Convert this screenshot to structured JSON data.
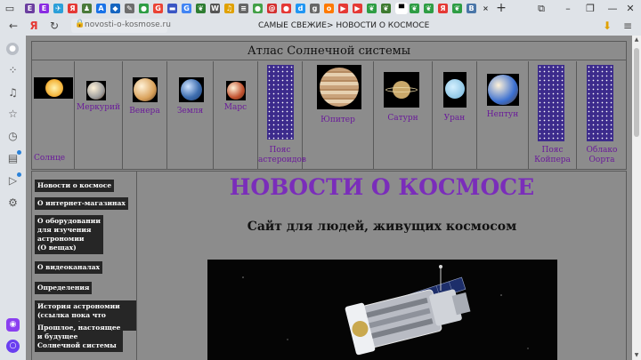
{
  "browser": {
    "tabs": [
      {
        "icon": "dzen-icon",
        "color": "#6b3fa0",
        "glyph": "Е"
      },
      {
        "icon": "dzen-icon",
        "color": "#8a2be2",
        "glyph": "Е"
      },
      {
        "icon": "telegram-icon",
        "color": "#2b9fd9",
        "glyph": "✈"
      },
      {
        "icon": "yandex-icon",
        "color": "#e53935",
        "glyph": "Я"
      },
      {
        "icon": "game-icon",
        "color": "#4a7a3a",
        "glyph": "♟"
      },
      {
        "icon": "translate-icon",
        "color": "#1a73e8",
        "glyph": "A"
      },
      {
        "icon": "bookmark-icon",
        "color": "#1565c0",
        "glyph": "◆"
      },
      {
        "icon": "feather-icon",
        "color": "#6d6d6d",
        "glyph": "✎"
      },
      {
        "icon": "green-circle-icon",
        "color": "#2e9d44",
        "glyph": "●"
      },
      {
        "icon": "google-icon",
        "color": "#ea4335",
        "glyph": "G"
      },
      {
        "icon": "flag-icon",
        "color": "#3a56c4",
        "glyph": "▬"
      },
      {
        "icon": "g-icon",
        "color": "#4285f4",
        "glyph": "G"
      },
      {
        "icon": "leaf-icon",
        "color": "#2e7d32",
        "glyph": "❦"
      },
      {
        "icon": "w-icon",
        "color": "#555555",
        "glyph": "W"
      },
      {
        "icon": "bird-icon",
        "color": "#e0a100",
        "glyph": "♫"
      },
      {
        "icon": "fan-icon",
        "color": "#666666",
        "glyph": "≡"
      },
      {
        "icon": "green-dot-icon",
        "color": "#43a047",
        "glyph": "●"
      },
      {
        "icon": "mail-icon",
        "color": "#d32f2f",
        "glyph": "@"
      },
      {
        "icon": "pin-icon",
        "color": "#e53935",
        "glyph": "●"
      },
      {
        "icon": "d-icon",
        "color": "#2196f3",
        "glyph": "d"
      },
      {
        "icon": "g-icon",
        "color": "#666666",
        "glyph": "g"
      },
      {
        "icon": "ok-icon",
        "color": "#ff7a00",
        "glyph": "o"
      },
      {
        "icon": "youtube-icon",
        "color": "#e53935",
        "glyph": "▶"
      },
      {
        "icon": "youtube-icon",
        "color": "#e53935",
        "glyph": "▶"
      },
      {
        "icon": "leaf-icon",
        "color": "#2e9d44",
        "glyph": "❦"
      },
      {
        "icon": "leaf-icon",
        "color": "#3d7a30",
        "glyph": "❦"
      },
      {
        "icon": "current-tab-icon",
        "color": "#ffffff",
        "glyph": "▀"
      },
      {
        "icon": "leaf-icon",
        "color": "#2e9d44",
        "glyph": "❦"
      },
      {
        "icon": "leaf-icon",
        "color": "#2e9d44",
        "glyph": "❦"
      },
      {
        "icon": "yandex-icon",
        "color": "#e53935",
        "glyph": "Я"
      },
      {
        "icon": "leaf-icon",
        "color": "#2e9d44",
        "glyph": "❦"
      },
      {
        "icon": "vk-icon",
        "color": "#4a76a8",
        "glyph": "В"
      },
      {
        "icon": "close-icon",
        "color": "#dfe3e8",
        "glyph": "×"
      }
    ],
    "new_tab_glyph": "+",
    "url": "novosti-o-kosmose.ru",
    "page_title": "САМЫЕ СВЕЖИЕ> НОВОСТИ О КОСМОСЕ"
  },
  "page": {
    "table_title": "Атлас Солнечной системы",
    "planets": [
      {
        "label": "Солнце",
        "color": "#f5b942"
      },
      {
        "label": "Меркурий",
        "color": "#9e9e9e"
      },
      {
        "label": "Венера",
        "color": "#d9a15a"
      },
      {
        "label": "Земля",
        "color": "#3f6fb0"
      },
      {
        "label": "Марс",
        "color": "#c1502e"
      },
      {
        "label": "Пояс астероидов",
        "color": "#3c2b8c"
      },
      {
        "label": "Юпитер",
        "color": "#d8b48a"
      },
      {
        "label": "Сатурн",
        "color": "#c9a86a"
      },
      {
        "label": "Уран",
        "color": "#6fb3d9"
      },
      {
        "label": "Нептун",
        "color": "#3a6fd1"
      },
      {
        "label": "Пояс Койпера",
        "color": "#3c2b8c"
      },
      {
        "label": "Облако Оорта",
        "color": "#3c2b8c"
      }
    ],
    "menu": [
      "Новости о космосе",
      "О интернет-магазинах",
      "О оборудовании\nдля изучения\nастрономии\n(О вещах)",
      "О видеоканалах",
      "Определения",
      "История астрономии\n(ссылка пока что неактивна)",
      "Прошлое, настоящее\nи будущее\nСолнечной системы"
    ],
    "heading": "НОВОСТИ О КОСМОСЕ",
    "subheading": "Сайт для людей, живущих космосом"
  },
  "colors": {
    "page_bg": "#8c8c8c",
    "heading": "#7a2dba",
    "link": "#6a1b9a",
    "menu_button": "#262626"
  }
}
